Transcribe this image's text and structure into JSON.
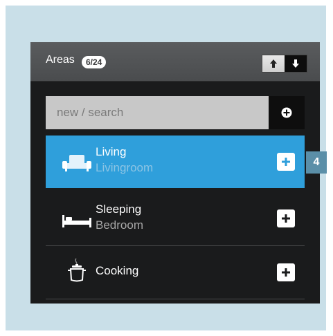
{
  "header": {
    "title": "Areas",
    "count": "6/24"
  },
  "search": {
    "placeholder": "new / search"
  },
  "items": [
    {
      "label": "Living",
      "sub": "Livingroom",
      "icon": "sofa-icon",
      "active": true
    },
    {
      "label": "Sleeping",
      "sub": "Bedroom",
      "icon": "bed-icon",
      "active": false
    },
    {
      "label": "Cooking",
      "sub": "",
      "icon": "cooking-pot-icon",
      "active": false
    }
  ],
  "callout": {
    "number": "4"
  },
  "colors": {
    "accent": "#2f9fdb",
    "panel": "#1a1b1c",
    "header": "#505254",
    "frame": "#c9dfe8"
  }
}
